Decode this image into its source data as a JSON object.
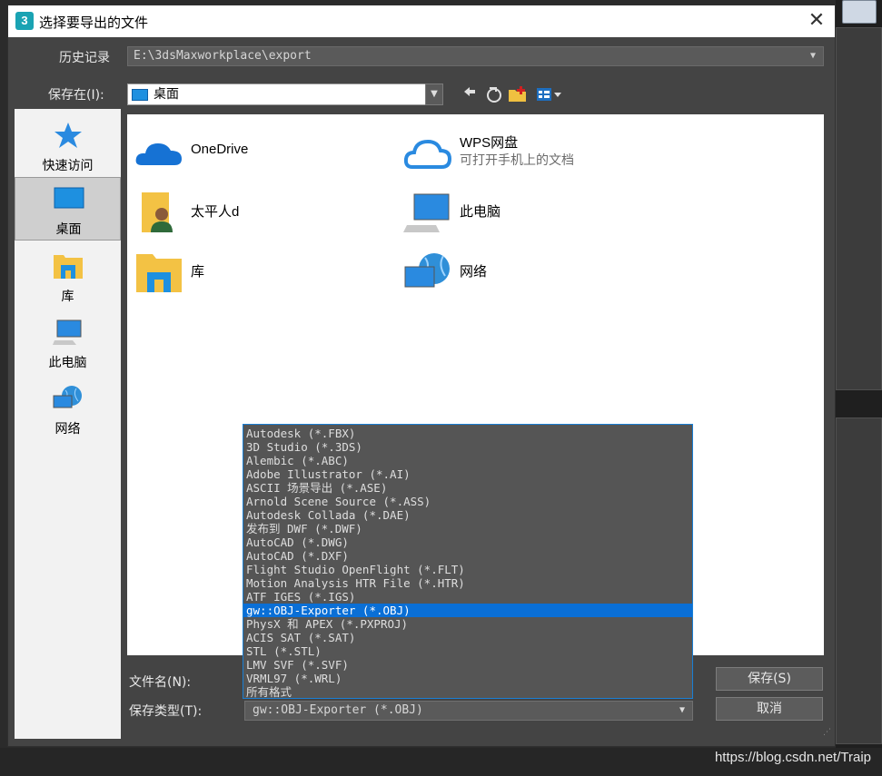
{
  "dialog": {
    "title": "选择要导出的文件",
    "app_icon_text": "3",
    "close_glyph": "✕"
  },
  "history": {
    "label": "历史记录",
    "path": "E:\\3dsMaxworkplace\\export"
  },
  "save_in": {
    "label": "保存在(I):",
    "value": "桌面"
  },
  "places": [
    {
      "label": "快速访问",
      "icon": "star-icon"
    },
    {
      "label": "桌面",
      "icon": "desktop-icon",
      "selected": true
    },
    {
      "label": "库",
      "icon": "library-icon"
    },
    {
      "label": "此电脑",
      "icon": "computer-icon"
    },
    {
      "label": "网络",
      "icon": "network-icon"
    }
  ],
  "files": [
    {
      "name": "OneDrive",
      "icon": "onedrive-cloud-icon"
    },
    {
      "name": "WPS网盘",
      "sub": "可打开手机上的文档",
      "icon": "wps-cloud-icon"
    },
    {
      "name": "太平人d",
      "icon": "user-folder-icon"
    },
    {
      "name": "此电脑",
      "icon": "computer-icon"
    },
    {
      "name": "库",
      "icon": "library-icon"
    },
    {
      "name": "网络",
      "icon": "network-icon"
    }
  ],
  "filename": {
    "label": "文件名(N):",
    "value": ""
  },
  "filetype": {
    "label": "保存类型(T):",
    "selected": "gw::OBJ-Exporter (*.OBJ)",
    "options": [
      "Autodesk (*.FBX)",
      "3D Studio (*.3DS)",
      "Alembic (*.ABC)",
      "Adobe Illustrator (*.AI)",
      "ASCII 场景导出 (*.ASE)",
      "Arnold Scene Source (*.ASS)",
      "Autodesk Collada (*.DAE)",
      "发布到 DWF (*.DWF)",
      "AutoCAD (*.DWG)",
      "AutoCAD (*.DXF)",
      "Flight Studio OpenFlight (*.FLT)",
      "Motion Analysis HTR File (*.HTR)",
      "ATF IGES (*.IGS)",
      "gw::OBJ-Exporter (*.OBJ)",
      "PhysX 和 APEX (*.PXPROJ)",
      "ACIS SAT (*.SAT)",
      "STL (*.STL)",
      "LMV SVF (*.SVF)",
      "VRML97 (*.WRL)",
      "所有格式"
    ]
  },
  "buttons": {
    "save": "保存(S)",
    "cancel": "取消"
  },
  "watermark": "https://blog.csdn.net/Traip",
  "colors": {
    "selection": "#0a6fd6",
    "dialog_bg": "#444444"
  }
}
